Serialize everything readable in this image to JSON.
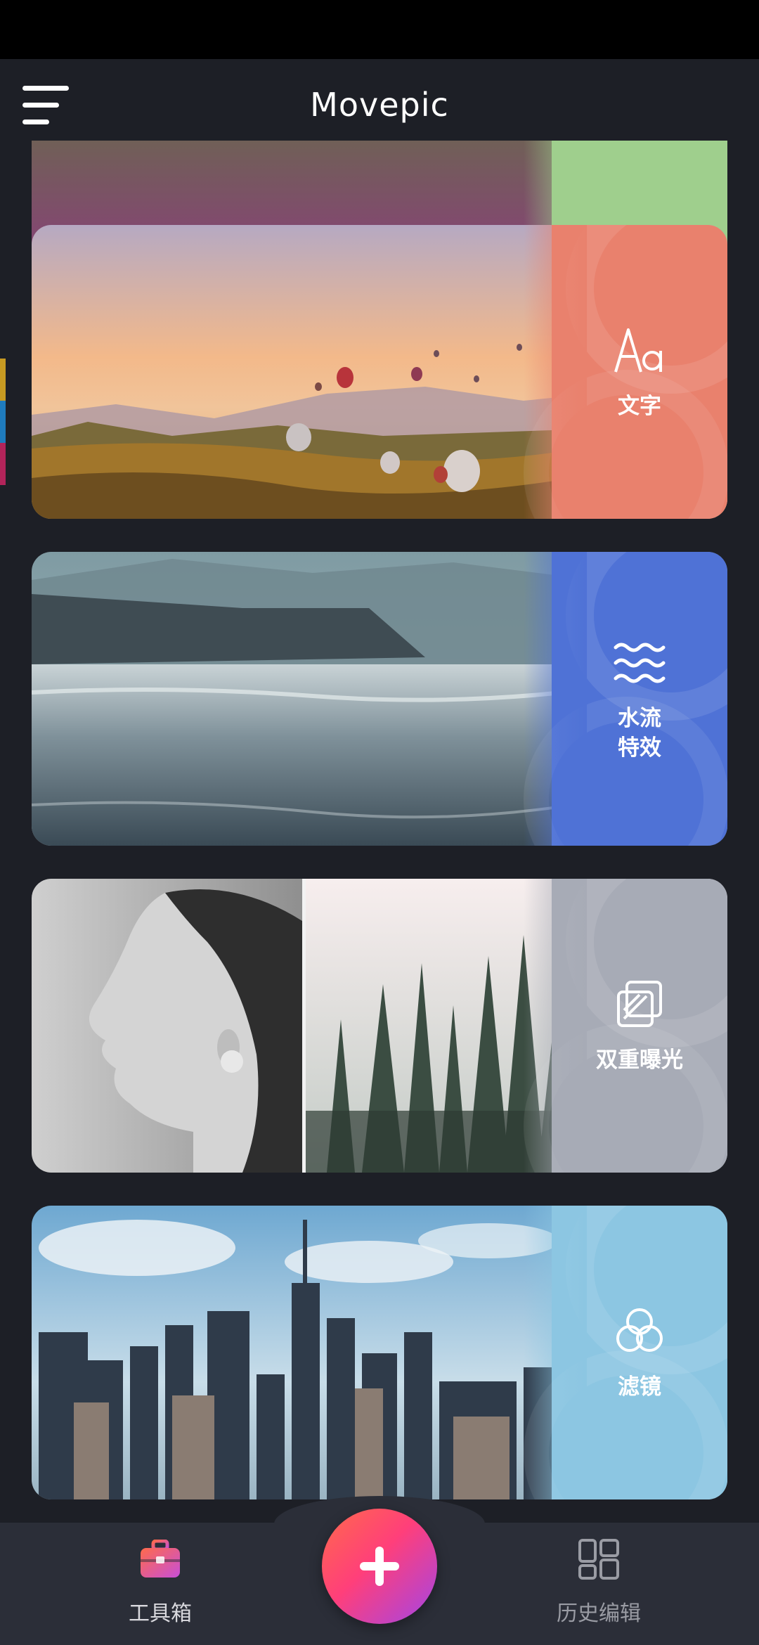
{
  "app": {
    "title": "Movepic"
  },
  "cards": [
    {
      "label": "文字",
      "icon": "text-aa-icon",
      "panel_color": "#e9816d"
    },
    {
      "label": "水流\n特效",
      "icon": "water-waves-icon",
      "panel_color": "#4f72d6"
    },
    {
      "label": "双重曝光",
      "icon": "double-exposure-icon",
      "panel_color": "#a7abb6"
    },
    {
      "label": "滤镜",
      "icon": "filter-circles-icon",
      "panel_color": "#8cc6e2"
    }
  ],
  "bottom_nav": {
    "left_label": "工具箱",
    "right_label": "历史编辑",
    "left_icon": "toolbox-icon",
    "right_icon": "grid-icon",
    "center_icon": "plus-icon"
  },
  "colors": {
    "background": "#1d1f26",
    "nav_background": "#2b2e38",
    "accent_start": "#ff6a4b",
    "accent_end": "#a245e8"
  }
}
